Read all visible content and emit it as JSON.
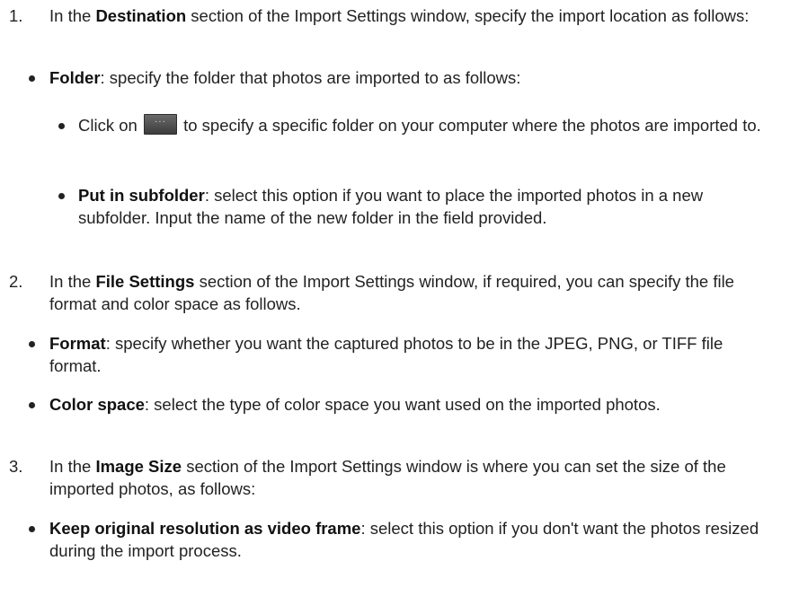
{
  "steps": [
    {
      "num": "1.",
      "pre": "In the ",
      "bold": "Destination",
      "post": " section of the Import Settings window, specify the import location as follows:"
    },
    {
      "num": "2.",
      "pre": "In the ",
      "bold": "File Settings",
      "post": " section of the Import Settings window, if required, you can specify the file format and color space as follows."
    },
    {
      "num": "3.",
      "pre": "In the ",
      "bold": "Image Size",
      "post": " section of the Import Settings window is where you can set the size of the imported photos, as follows:"
    }
  ],
  "folder": {
    "bold": "Folder",
    "text": ": specify the folder that photos are imported to as follows:",
    "click_pre": "Click on ",
    "browse_button_label": "···",
    "click_post": " to specify a specific folder on your computer where the photos are imported to.",
    "subfolder_bold": "Put in subfolder",
    "subfolder_text": ": select this option if you want to place the imported photos in a new subfolder. Input the name of the new folder in the field provided."
  },
  "file_settings": {
    "format_bold": "Format",
    "format_text": ": specify whether you want the captured photos to be in the JPEG, PNG, or TIFF file format.",
    "color_bold": "Color space",
    "color_text": ": select the type of color space you want used on the imported photos."
  },
  "image_size": {
    "keep_bold": "Keep original resolution as video frame",
    "keep_text": ": select this option if you don't want the photos resized during the import process."
  }
}
